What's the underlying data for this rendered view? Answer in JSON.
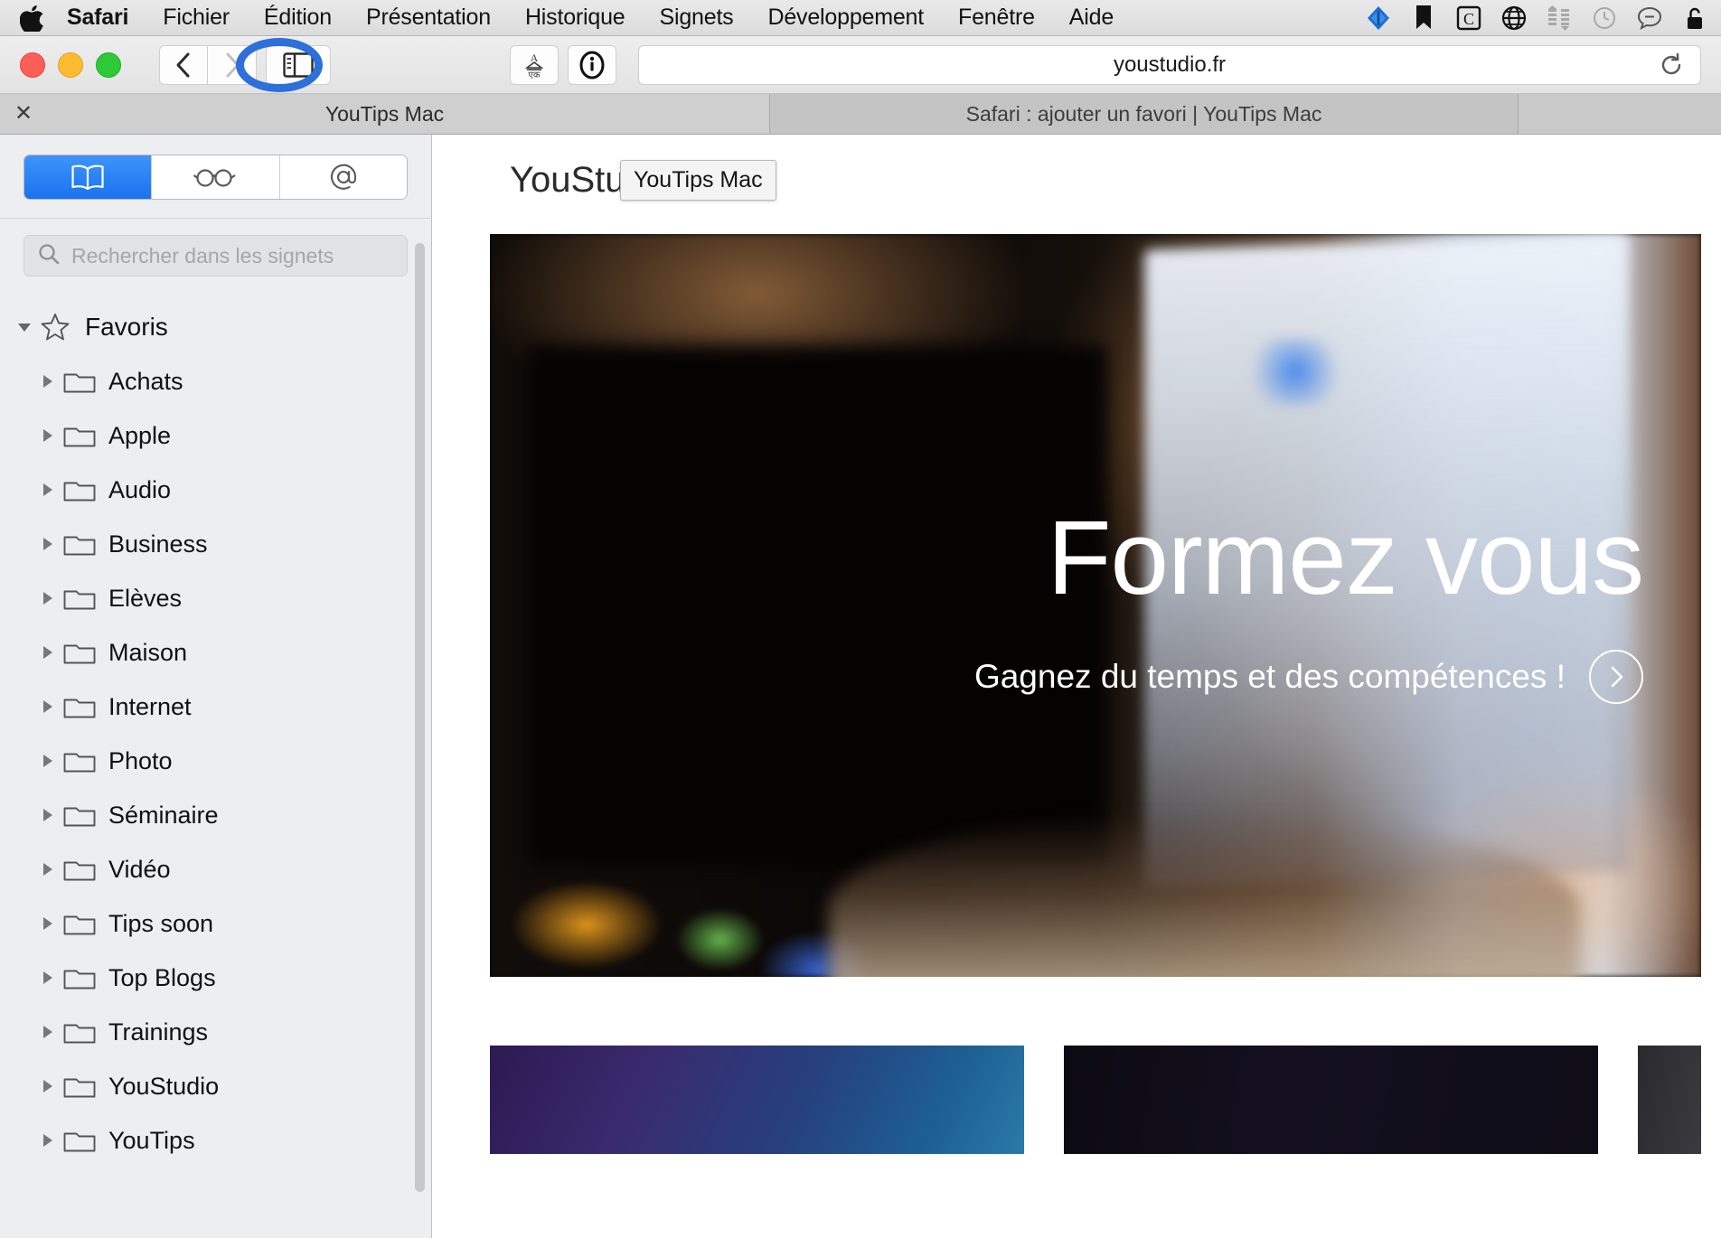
{
  "menubar": {
    "apple_icon": "apple-logo",
    "items": [
      {
        "label": "Safari",
        "bold": true
      },
      {
        "label": "Fichier",
        "bold": false
      },
      {
        "label": "Édition",
        "bold": false
      },
      {
        "label": "Présentation",
        "bold": false
      },
      {
        "label": "Historique",
        "bold": false
      },
      {
        "label": "Signets",
        "bold": false
      },
      {
        "label": "Développement",
        "bold": false
      },
      {
        "label": "Fenêtre",
        "bold": false
      },
      {
        "label": "Aide",
        "bold": false
      }
    ],
    "status_icons": [
      {
        "name": "dropbox-icon",
        "color": "#1a6fd4"
      },
      {
        "name": "bookmark-icon",
        "color": "#111111"
      },
      {
        "name": "copy-clip-icon",
        "color": "#111111"
      },
      {
        "name": "globe-icon",
        "color": "#111111"
      },
      {
        "name": "transfer-icon",
        "color": "#a8a8a8"
      },
      {
        "name": "clock-history-icon",
        "color": "#a8a8a8"
      },
      {
        "name": "chat-bubble-icon",
        "color": "#555555"
      },
      {
        "name": "lock-open-icon",
        "color": "#111111"
      }
    ]
  },
  "toolbar": {
    "traffic_lights": [
      {
        "name": "close-window-button",
        "color": "#fc5f57"
      },
      {
        "name": "minimize-window-button",
        "color": "#fdbc2f"
      },
      {
        "name": "zoom-window-button",
        "color": "#2dc937"
      }
    ],
    "back_label": "Précédent",
    "forward_label": "Suivant",
    "sidebar_toggle_label": "Afficher la barre latérale",
    "sidebar_toggle_highlighted": true,
    "highlight_color": "#2d6fdb",
    "translate_label": "Traduire",
    "reader_label": "Lecteur",
    "url": "youstudio.fr",
    "reload_label": "Recharger"
  },
  "tabs": [
    {
      "title": "YouTips Mac",
      "active": true,
      "close_glyph": "✕"
    },
    {
      "title": "Safari : ajouter un favori | YouTips Mac",
      "active": false
    }
  ],
  "sidebar": {
    "segments": [
      {
        "name": "bookmarks-tab",
        "icon": "book-icon",
        "selected": true
      },
      {
        "name": "reading-list-tab",
        "icon": "glasses-icon",
        "selected": false
      },
      {
        "name": "shared-links-tab",
        "icon": "at-sign-icon",
        "selected": false
      }
    ],
    "search": {
      "placeholder": "Rechercher dans les signets",
      "value": "",
      "icon": "search-icon"
    },
    "root": {
      "label": "Favoris",
      "icon": "star-icon",
      "expanded": true,
      "disclosure": "▼"
    },
    "folders": [
      {
        "label": "Achats"
      },
      {
        "label": "Apple"
      },
      {
        "label": "Audio"
      },
      {
        "label": "Business"
      },
      {
        "label": "Elèves"
      },
      {
        "label": "Maison"
      },
      {
        "label": "Internet"
      },
      {
        "label": "Photo"
      },
      {
        "label": "Séminaire"
      },
      {
        "label": "Vidéo"
      },
      {
        "label": "Tips soon"
      },
      {
        "label": "Top Blogs"
      },
      {
        "label": "Trainings"
      },
      {
        "label": "YouStudio"
      },
      {
        "label": "YouTips"
      }
    ]
  },
  "page": {
    "site_title": "YouStudio F",
    "drag_ghost_label": "YouTips Mac",
    "hero": {
      "headline": "Formez vous",
      "subheadline": "Gagnez du temps et des compétences !",
      "arrow_glyph": "›"
    },
    "cards": [
      {
        "name": "card-purple"
      },
      {
        "name": "card-dark"
      },
      {
        "name": "card-edge"
      }
    ]
  }
}
